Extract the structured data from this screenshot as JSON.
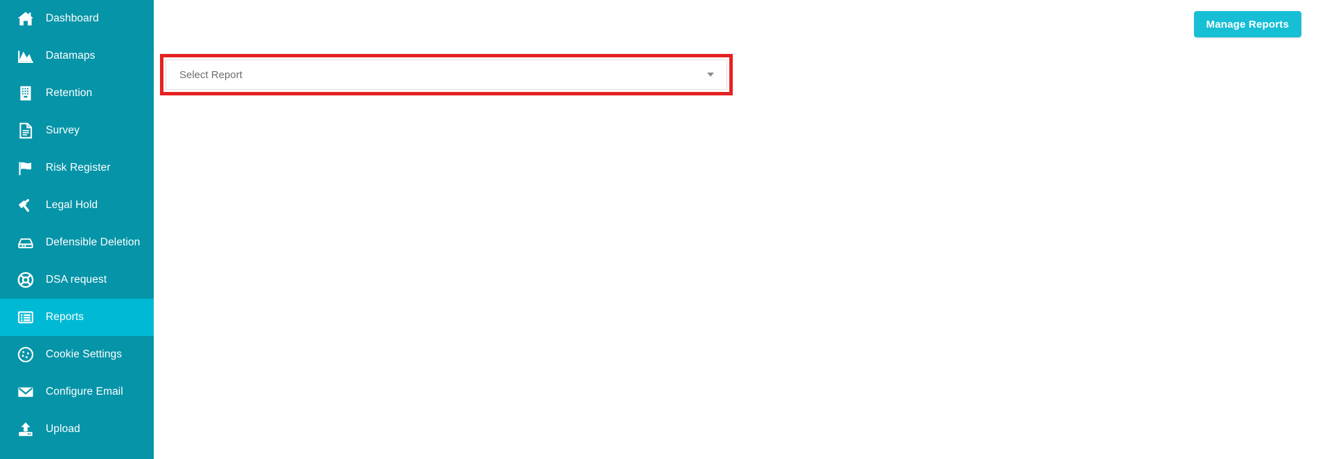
{
  "sidebar": {
    "background_color": "#0594a8",
    "active_color": "#00b9d4",
    "items": [
      {
        "label": "Dashboard",
        "icon": "home-icon",
        "active": false
      },
      {
        "label": "Datamaps",
        "icon": "area-chart-icon",
        "active": false
      },
      {
        "label": "Retention",
        "icon": "building-icon",
        "active": false
      },
      {
        "label": "Survey",
        "icon": "document-icon",
        "active": false
      },
      {
        "label": "Risk Register",
        "icon": "flag-icon",
        "active": false
      },
      {
        "label": "Legal Hold",
        "icon": "gavel-icon",
        "active": false
      },
      {
        "label": "Defensible Deletion",
        "icon": "hard-drive-icon",
        "active": false
      },
      {
        "label": "DSA request",
        "icon": "lifebuoy-icon",
        "active": false
      },
      {
        "label": "Reports",
        "icon": "list-report-icon",
        "active": true
      },
      {
        "label": "Cookie Settings",
        "icon": "cookie-icon",
        "active": false
      },
      {
        "label": "Configure Email",
        "icon": "envelope-icon",
        "active": false
      },
      {
        "label": "Upload",
        "icon": "upload-icon",
        "active": false
      }
    ]
  },
  "main": {
    "manage_reports_button": {
      "label": "Manage Reports",
      "color": "#17bfd5"
    },
    "report_select": {
      "value": "",
      "placeholder": "Select Report",
      "caret_icon": "chevron-down-icon"
    },
    "highlight": {
      "color": "#e52222"
    }
  }
}
